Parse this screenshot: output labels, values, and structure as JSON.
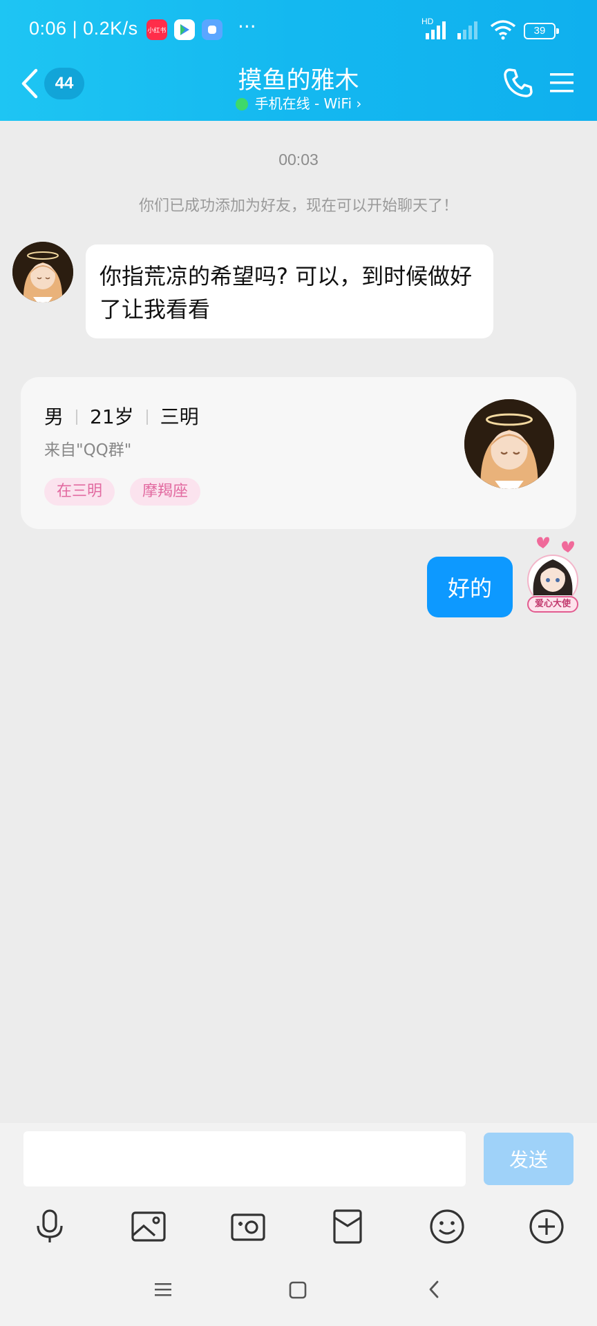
{
  "status_bar": {
    "time": "0:06",
    "net_speed": "0.2K/s",
    "app_icon_1": "小红书",
    "more": "···",
    "hd": "HD",
    "battery": "39"
  },
  "header": {
    "back_badge": "44",
    "title": "摸鱼的雅木",
    "subtitle": "手机在线 - WiFi",
    "subtitle_arrow": "›"
  },
  "chat": {
    "timestamp": "00:03",
    "system_message": "你们已成功添加为好友，现在可以开始聊天了！",
    "incoming_message": "你指荒凉的希望吗? 可以，到时候做好了让我看看",
    "outgoing_message": "好的"
  },
  "profile_card": {
    "gender": "男",
    "age": "21岁",
    "city": "三明",
    "source": "来自\"QQ群\"",
    "tags": [
      "在三明",
      "摩羯座"
    ]
  },
  "sticker": {
    "label": "爱心大使"
  },
  "input": {
    "placeholder": "",
    "send_label": "发送"
  },
  "toolbar": {
    "icons": [
      "microphone-icon",
      "image-icon",
      "camera-icon",
      "red-packet-icon",
      "emoji-icon",
      "plus-icon"
    ]
  },
  "colors": {
    "header_bg": "#14b8f0",
    "outgoing_bubble": "#0d99ff",
    "send_button": "#9fd2f9",
    "tag_bg": "#fbe3ee",
    "tag_text": "#e26aa0"
  }
}
